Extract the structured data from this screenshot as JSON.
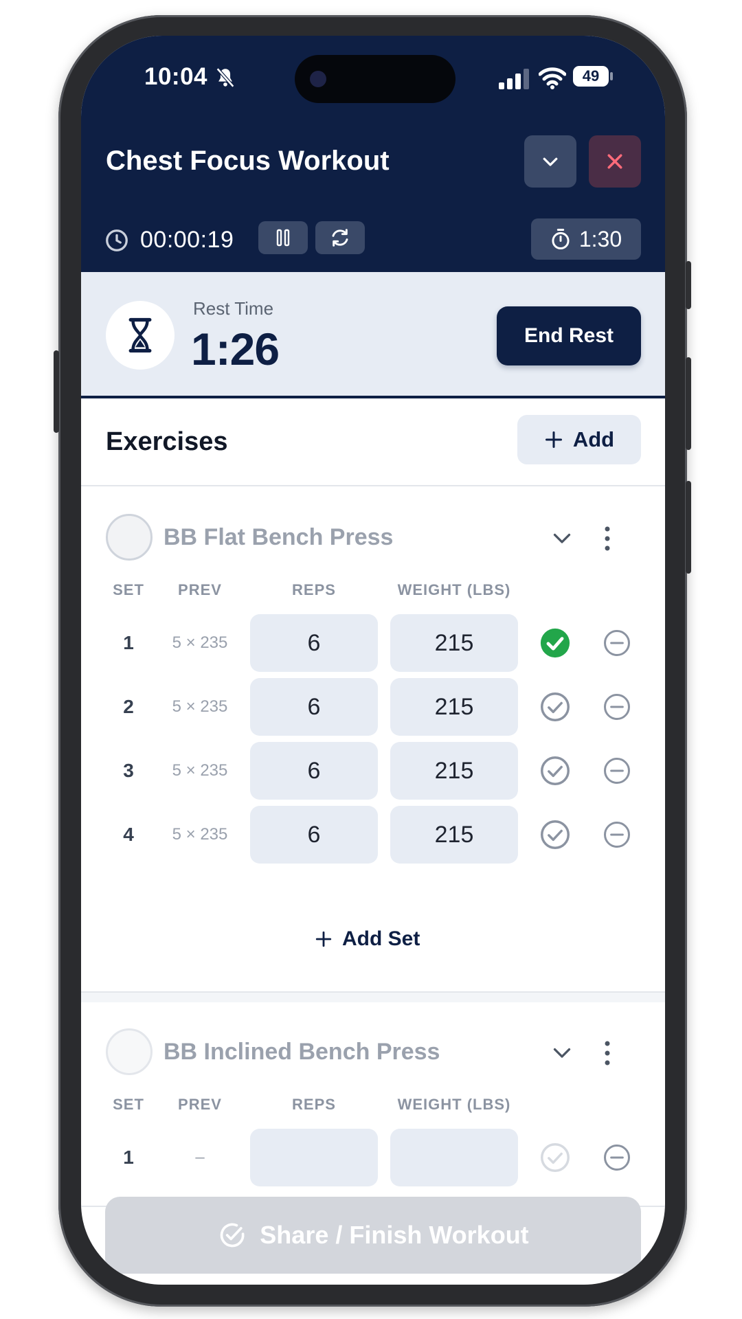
{
  "status_bar": {
    "time": "10:04",
    "battery": "49",
    "icons": [
      "bell-slash-icon",
      "signal-icon",
      "wifi-icon",
      "battery-icon"
    ]
  },
  "header": {
    "title": "Chest Focus Workout",
    "elapsed": "00:00:19",
    "rest_setting": "1:30",
    "icons": [
      "chevron-down-icon",
      "close-icon",
      "clock-icon",
      "pause-icon",
      "refresh-icon",
      "stopwatch-icon"
    ]
  },
  "rest": {
    "label": "Rest Time",
    "countdown": "1:26",
    "end_label": "End Rest"
  },
  "exercises": {
    "title": "Exercises",
    "add_label": "Add",
    "columns": {
      "set": "SET",
      "prev": "PREV",
      "reps": "REPS",
      "weight": "WEIGHT (LBS)"
    },
    "items": [
      {
        "name": "BB Flat Bench Press",
        "sets": [
          {
            "num": "1",
            "prev": "5 × 235",
            "reps": "6",
            "weight": "215",
            "completed": true
          },
          {
            "num": "2",
            "prev": "5 × 235",
            "reps": "6",
            "weight": "215",
            "completed": false
          },
          {
            "num": "3",
            "prev": "5 × 235",
            "reps": "6",
            "weight": "215",
            "completed": false
          },
          {
            "num": "4",
            "prev": "5 × 235",
            "reps": "6",
            "weight": "215",
            "completed": false
          }
        ],
        "add_set_label": "Add Set"
      },
      {
        "name": "BB Inclined Bench Press",
        "sets": [
          {
            "num": "1",
            "prev": "–",
            "reps": "",
            "weight": "",
            "completed": false
          }
        ]
      }
    ]
  },
  "footer": {
    "finish_label": "Share / Finish Workout"
  },
  "colors": {
    "navy": "#0e1f44",
    "accent_green": "#22a64a",
    "close_red": "#ff6b7a",
    "field_bg": "#e7ecf4"
  }
}
